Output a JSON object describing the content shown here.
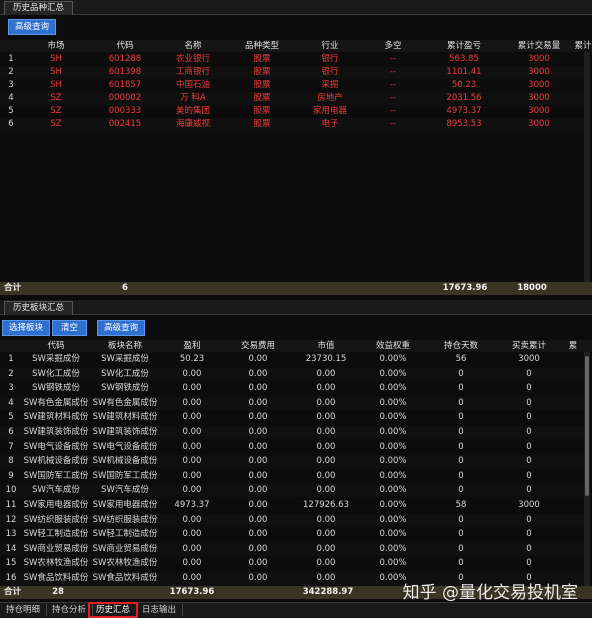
{
  "top": {
    "tab": "历史品种汇总",
    "btn_query": "高级查询",
    "columns": [
      "",
      "市场",
      "代码",
      "名称",
      "品种类型",
      "行业",
      "多空",
      "累计盈亏",
      "累计交易量",
      "累计"
    ],
    "rows": [
      [
        "1",
        "SH",
        "601288",
        "农业银行",
        "股票",
        "银行",
        "--",
        "563.85",
        "3000"
      ],
      [
        "2",
        "SH",
        "601398",
        "工商银行",
        "股票",
        "银行",
        "--",
        "1101.41",
        "3000"
      ],
      [
        "3",
        "SH",
        "601857",
        "中国石油",
        "股票",
        "采掘",
        "--",
        "50.23",
        "3000"
      ],
      [
        "4",
        "SZ",
        "000002",
        "万 科A",
        "股票",
        "房地产",
        "--",
        "2031.56",
        "3000"
      ],
      [
        "5",
        "SZ",
        "000333",
        "美的集团",
        "股票",
        "家用电器",
        "--",
        "4973.37",
        "3000"
      ],
      [
        "6",
        "SZ",
        "002415",
        "海康威视",
        "股票",
        "电子",
        "--",
        "8953.53",
        "3000"
      ]
    ],
    "summary": {
      "label": "合计",
      "count": "6",
      "pnl": "17673.96",
      "volume": "18000"
    }
  },
  "bottom": {
    "tab": "历史板块汇总",
    "btn_select": "选择板块",
    "btn_clear": "清空",
    "btn_query": "高级查询",
    "columns": [
      "",
      "代码",
      "板块名称",
      "盈利",
      "交易费用",
      "市值",
      "效益权重",
      "持仓天数",
      "买卖累计",
      "累"
    ],
    "rows": [
      [
        "1",
        "SW采掘成份",
        "SW采掘成份",
        "50.23",
        "0.00",
        "23730.15",
        "0.00%",
        "56",
        "3000"
      ],
      [
        "2",
        "SW化工成份",
        "SW化工成份",
        "0.00",
        "0.00",
        "0.00",
        "0.00%",
        "0",
        "0"
      ],
      [
        "3",
        "SW钢铁成份",
        "SW钢铁成份",
        "0.00",
        "0.00",
        "0.00",
        "0.00%",
        "0",
        "0"
      ],
      [
        "4",
        "SW有色金属成份",
        "SW有色金属成份",
        "0.00",
        "0.00",
        "0.00",
        "0.00%",
        "0",
        "0"
      ],
      [
        "5",
        "SW建筑材料成份",
        "SW建筑材料成份",
        "0.00",
        "0.00",
        "0.00",
        "0.00%",
        "0",
        "0"
      ],
      [
        "6",
        "SW建筑装饰成份",
        "SW建筑装饰成份",
        "0.00",
        "0.00",
        "0.00",
        "0.00%",
        "0",
        "0"
      ],
      [
        "7",
        "SW电气设备成份",
        "SW电气设备成份",
        "0.00",
        "0.00",
        "0.00",
        "0.00%",
        "0",
        "0"
      ],
      [
        "8",
        "SW机械设备成份",
        "SW机械设备成份",
        "0.00",
        "0.00",
        "0.00",
        "0.00%",
        "0",
        "0"
      ],
      [
        "9",
        "SW国防军工成份",
        "SW国防军工成份",
        "0.00",
        "0.00",
        "0.00",
        "0.00%",
        "0",
        "0"
      ],
      [
        "10",
        "SW汽车成份",
        "SW汽车成份",
        "0.00",
        "0.00",
        "0.00",
        "0.00%",
        "0",
        "0"
      ],
      [
        "11",
        "SW家用电器成份",
        "SW家用电器成份",
        "4973.37",
        "0.00",
        "127926.63",
        "0.00%",
        "58",
        "3000"
      ],
      [
        "12",
        "SW纺织服装成份",
        "SW纺织服装成份",
        "0.00",
        "0.00",
        "0.00",
        "0.00%",
        "0",
        "0"
      ],
      [
        "13",
        "SW轻工制造成份",
        "SW轻工制造成份",
        "0.00",
        "0.00",
        "0.00",
        "0.00%",
        "0",
        "0"
      ],
      [
        "14",
        "SW商业贸易成份",
        "SW商业贸易成份",
        "0.00",
        "0.00",
        "0.00",
        "0.00%",
        "0",
        "0"
      ],
      [
        "15",
        "SW农林牧渔成份",
        "SW农林牧渔成份",
        "0.00",
        "0.00",
        "0.00",
        "0.00%",
        "0",
        "0"
      ],
      [
        "16",
        "SW食品饮料成份",
        "SW食品饮料成份",
        "0.00",
        "0.00",
        "0.00",
        "0.00%",
        "0",
        "0"
      ]
    ],
    "summary": {
      "label": "合计",
      "count": "28",
      "pnl": "17673.96",
      "value": "342288.97"
    }
  },
  "bottom_tabs": [
    "持仓明细",
    "持仓分析",
    "历史汇总",
    "日志输出"
  ],
  "watermark": "知乎 @量化交易投机室"
}
